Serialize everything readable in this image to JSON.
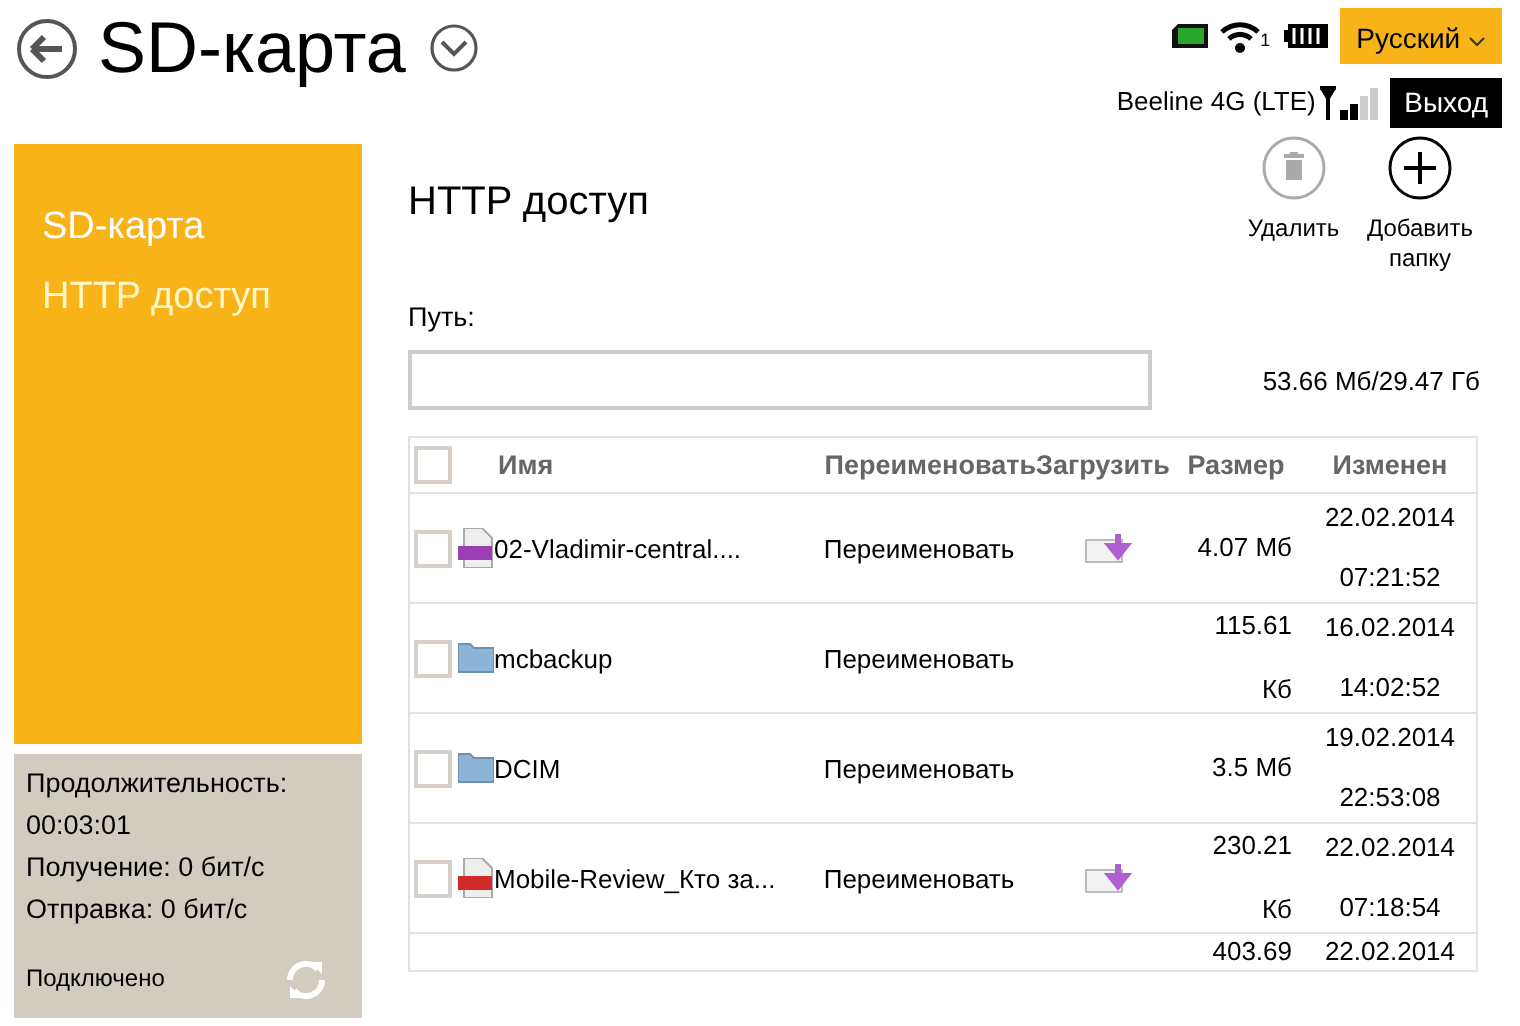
{
  "header": {
    "title": "SD-карта",
    "language": "Русский",
    "network": "Beeline 4G (LTE)",
    "wifi_clients": "1",
    "logout": "Выход"
  },
  "sidebar": {
    "items": [
      {
        "label": "SD-карта",
        "selected": false
      },
      {
        "label": "HTTP доступ",
        "selected": true
      }
    ],
    "status": {
      "lines": [
        "Продолжительность:",
        "00:03:01",
        "Получение: 0 бит/с",
        "Отправка: 0 бит/с"
      ],
      "connection": "Подключено"
    }
  },
  "main": {
    "title": "HTTP доступ",
    "toolbar": [
      {
        "label": "Удалить",
        "kind": "delete",
        "disabled": true
      },
      {
        "label": "Добавить папку",
        "kind": "add",
        "disabled": false
      }
    ],
    "path_label": "Путь:",
    "storage": "53.66 Мб/29.47 Гб",
    "table": {
      "select_all_checked": false,
      "columns": [
        "Имя",
        "Переименовать",
        "Загрузить",
        "Размер",
        "Изменен"
      ],
      "rows": [
        {
          "kind": "mp3",
          "name": "02-Vladimir-central....",
          "rename": "Переименовать",
          "downloadable": true,
          "size": "4.07 Мб",
          "date": "22.02.2014",
          "time": "07:21:52",
          "checked": false
        },
        {
          "kind": "folder",
          "name": "mcbackup",
          "rename": "Переименовать",
          "downloadable": false,
          "size": "115.61 Кб",
          "date": "16.02.2014",
          "time": "14:02:52",
          "checked": false
        },
        {
          "kind": "folder",
          "name": "DCIM",
          "rename": "Переименовать",
          "downloadable": false,
          "size": "3.5 Мб",
          "date": "19.02.2014",
          "time": "22:53:08",
          "checked": false
        },
        {
          "kind": "pdf",
          "name": "Mobile-Review_Кто за...",
          "rename": "Переименовать",
          "downloadable": true,
          "size": "230.21 Кб",
          "date": "22.02.2014",
          "time": "07:18:54",
          "checked": false
        },
        {
          "kind": "partial",
          "size": "403.69",
          "date": "22.02.2014"
        }
      ]
    }
  }
}
